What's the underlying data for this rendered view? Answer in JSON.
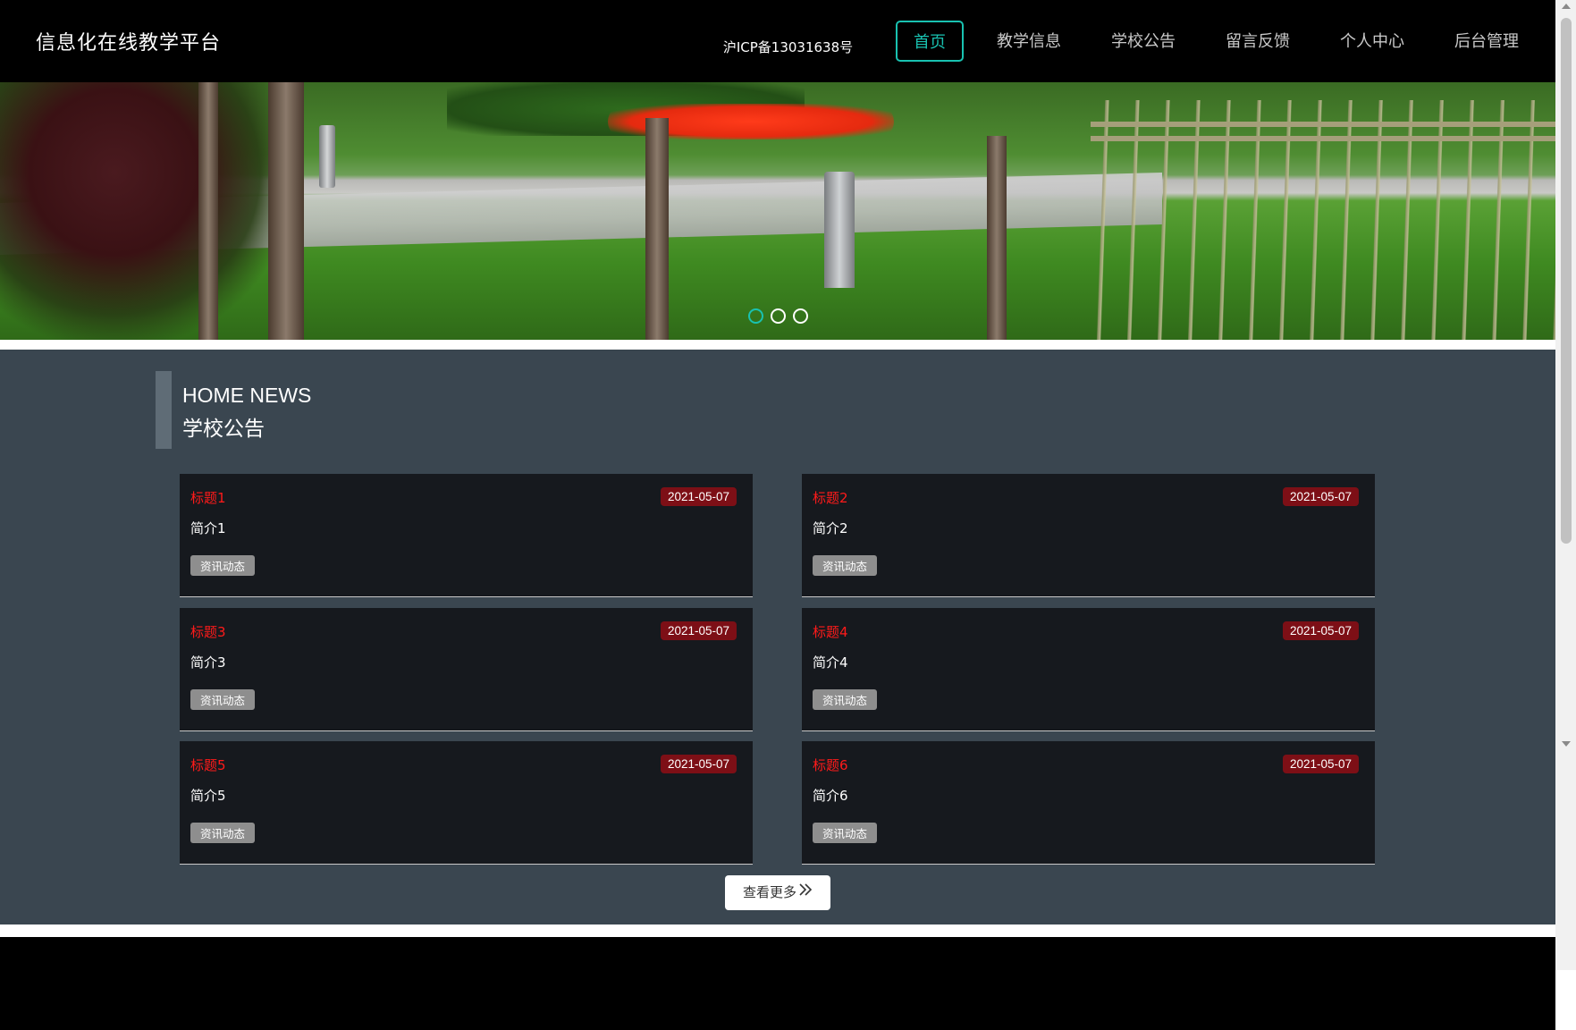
{
  "header": {
    "brand": "信息化在线教学平台",
    "nav": [
      "首页",
      "教学信息",
      "学校公告",
      "留言反馈",
      "个人中心",
      "后台管理"
    ],
    "active_nav": "首页"
  },
  "banner": {
    "slide_count": 3,
    "active_slide": 1
  },
  "news": {
    "heading_en": "HOME NEWS",
    "heading_cn": "学校公告",
    "items": [
      {
        "title": "标题1",
        "date": "2021-05-07",
        "desc": "简介1",
        "tag": "资讯动态"
      },
      {
        "title": "标题2",
        "date": "2021-05-07",
        "desc": "简介2",
        "tag": "资讯动态"
      },
      {
        "title": "标题3",
        "date": "2021-05-07",
        "desc": "简介3",
        "tag": "资讯动态"
      },
      {
        "title": "标题4",
        "date": "2021-05-07",
        "desc": "简介4",
        "tag": "资讯动态"
      },
      {
        "title": "标题5",
        "date": "2021-05-07",
        "desc": "简介5",
        "tag": "资讯动态"
      },
      {
        "title": "标题6",
        "date": "2021-05-07",
        "desc": "简介6",
        "tag": "资讯动态"
      }
    ],
    "more_label": "查看更多"
  },
  "footer": {
    "icp": "沪ICP备13031638号"
  },
  "colors": {
    "accent": "#19c2b1",
    "title_red": "#ff1a1a",
    "date_badge": "#7d0f16",
    "section_bg": "#3a4650",
    "card_bg": "#16191e"
  }
}
